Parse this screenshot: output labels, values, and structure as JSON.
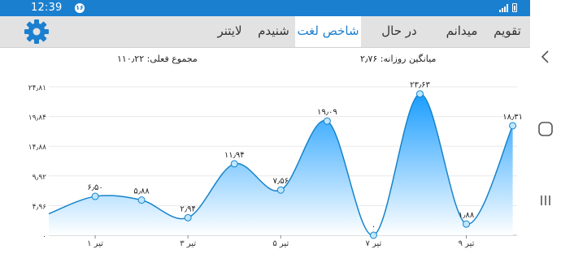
{
  "status_bar": {
    "time": "12:39",
    "notification_badge": "۱۶"
  },
  "settings_icon": "gear-icon",
  "tabs": [
    {
      "label": "تقویم",
      "active": false
    },
    {
      "label": "میدانم",
      "active": false
    },
    {
      "label": "در حال یادگیری",
      "active": false
    },
    {
      "label": "شاخص لغت",
      "active": true
    },
    {
      "label": "شنیدم",
      "active": false
    },
    {
      "label": "لایتنر",
      "active": false
    }
  ],
  "stats": {
    "total_actual": "مجموع فعلی: ۱۱۰٫۲۲",
    "daily_average": "میانگین روزانه: ۲٫۷۶"
  },
  "colors": {
    "accent": "#1b7fd0",
    "area_top": "#1a9dff",
    "area_bottom": "#ffffff",
    "point": "#bfe6ff"
  },
  "chart_data": {
    "type": "area",
    "y_ticks": [
      "۲۴٫۸۱",
      "۱۹٫۸۴",
      "۱۴٫۸۸",
      "۹٫۹۲",
      "۴٫۹۶",
      "۰"
    ],
    "ylim": [
      0,
      24.81
    ],
    "x_ticks": [
      {
        "index": 1,
        "label": "۱ تیر"
      },
      {
        "index": 3,
        "label": "۳ تیر"
      },
      {
        "index": 5,
        "label": "۵ تیر"
      },
      {
        "index": 7,
        "label": "۷ تیر"
      },
      {
        "index": 9,
        "label": "۹ تیر"
      }
    ],
    "x_range": [
      0,
      10.2
    ],
    "series": [
      {
        "points": [
          {
            "x": 0,
            "y": 3.6,
            "label": null
          },
          {
            "x": 1,
            "y": 6.5,
            "label": "۶٫۵۰"
          },
          {
            "x": 2,
            "y": 5.88,
            "label": "۵٫۸۸"
          },
          {
            "x": 3,
            "y": 2.94,
            "label": "۲٫۹۴"
          },
          {
            "x": 4,
            "y": 11.94,
            "label": "۱۱٫۹۴"
          },
          {
            "x": 5,
            "y": 7.56,
            "label": "۷٫۵۶"
          },
          {
            "x": 6,
            "y": 19.09,
            "label": "۱۹٫۰۹"
          },
          {
            "x": 7,
            "y": 0,
            "label": "۰"
          },
          {
            "x": 8,
            "y": 23.63,
            "label": "۲۳٫۶۳"
          },
          {
            "x": 9,
            "y": 1.88,
            "label": "۱٫۸۸"
          },
          {
            "x": 10,
            "y": 18.31,
            "label": "۱۸٫۳۱"
          }
        ]
      }
    ],
    "grid": true
  },
  "nav": {
    "back_icon": "chevron-left-icon",
    "home_icon": "home-icon",
    "recents_icon": "recents-icon"
  }
}
